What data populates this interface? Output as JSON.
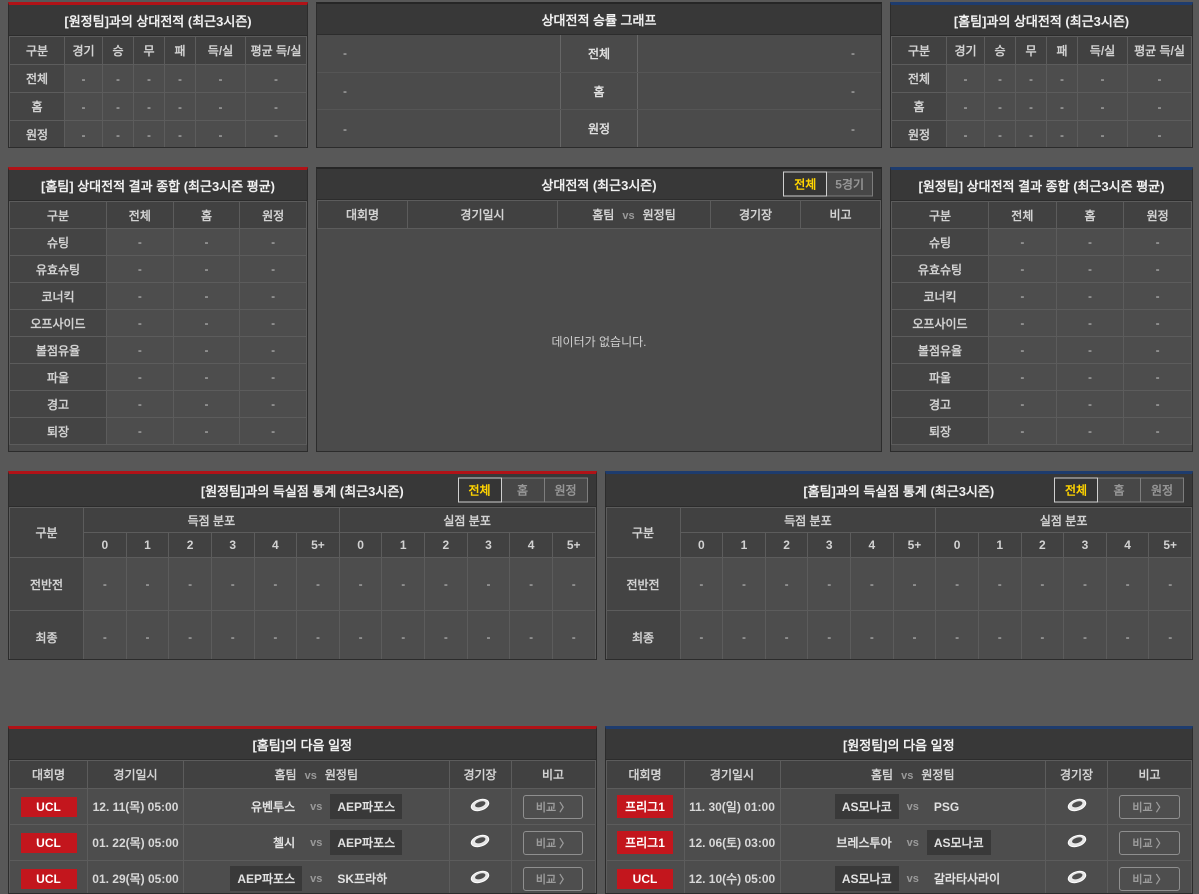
{
  "colors": {
    "accent_red": "#b11217",
    "accent_blue": "#1e3c6e",
    "badge_red": "#c3161d",
    "tab_active_text": "#ffd400",
    "page_background": "#585858"
  },
  "h2h_away": {
    "title": "[원정팀]과의 상대전적 (최근3시즌)",
    "columns": [
      "구분",
      "경기",
      "승",
      "무",
      "패",
      "득/실",
      "평균 득/실"
    ],
    "rows": [
      {
        "label": "전체",
        "values": [
          "-",
          "-",
          "-",
          "-",
          "-",
          "-"
        ]
      },
      {
        "label": "홈",
        "values": [
          "-",
          "-",
          "-",
          "-",
          "-",
          "-"
        ]
      },
      {
        "label": "원정",
        "values": [
          "-",
          "-",
          "-",
          "-",
          "-",
          "-"
        ]
      }
    ]
  },
  "winrate": {
    "title": "상대전적 승률 그래프",
    "rows": [
      {
        "left": "-",
        "label": "전체",
        "right": "-"
      },
      {
        "left": "-",
        "label": "홈",
        "right": "-"
      },
      {
        "left": "-",
        "label": "원정",
        "right": "-"
      }
    ]
  },
  "h2h_home": {
    "title": "[홈팀]과의 상대전적 (최근3시즌)",
    "columns": [
      "구분",
      "경기",
      "승",
      "무",
      "패",
      "득/실",
      "평균 득/실"
    ],
    "rows": [
      {
        "label": "전체",
        "values": [
          "-",
          "-",
          "-",
          "-",
          "-",
          "-"
        ]
      },
      {
        "label": "홈",
        "values": [
          "-",
          "-",
          "-",
          "-",
          "-",
          "-"
        ]
      },
      {
        "label": "원정",
        "values": [
          "-",
          "-",
          "-",
          "-",
          "-",
          "-"
        ]
      }
    ]
  },
  "summary_home": {
    "title": "[홈팀] 상대전적 결과 종합 (최근3시즌 평균)",
    "columns": [
      "구분",
      "전체",
      "홈",
      "원정"
    ],
    "rows": [
      {
        "label": "슈팅",
        "values": [
          "-",
          "-",
          "-"
        ]
      },
      {
        "label": "유효슈팅",
        "values": [
          "-",
          "-",
          "-"
        ]
      },
      {
        "label": "코너킥",
        "values": [
          "-",
          "-",
          "-"
        ]
      },
      {
        "label": "오프사이드",
        "values": [
          "-",
          "-",
          "-"
        ]
      },
      {
        "label": "볼점유율",
        "values": [
          "-",
          "-",
          "-"
        ]
      },
      {
        "label": "파울",
        "values": [
          "-",
          "-",
          "-"
        ]
      },
      {
        "label": "경고",
        "values": [
          "-",
          "-",
          "-"
        ]
      },
      {
        "label": "퇴장",
        "values": [
          "-",
          "-",
          "-"
        ]
      }
    ]
  },
  "matches": {
    "title": "상대전적 (최근3시즌)",
    "tabs": [
      {
        "label": "전체",
        "active": true
      },
      {
        "label": "5경기",
        "active": false
      }
    ],
    "header": {
      "league": "대회명",
      "datetime": "경기일시",
      "home": "홈팀",
      "vs": "vs",
      "away": "원정팀",
      "stadium": "경기장",
      "note": "비고"
    },
    "empty_message": "데이터가 없습니다."
  },
  "summary_away": {
    "title": "[원정팀] 상대전적 결과 종합 (최근3시즌 평균)",
    "columns": [
      "구분",
      "전체",
      "홈",
      "원정"
    ],
    "rows": [
      {
        "label": "슈팅",
        "values": [
          "-",
          "-",
          "-"
        ]
      },
      {
        "label": "유효슈팅",
        "values": [
          "-",
          "-",
          "-"
        ]
      },
      {
        "label": "코너킥",
        "values": [
          "-",
          "-",
          "-"
        ]
      },
      {
        "label": "오프사이드",
        "values": [
          "-",
          "-",
          "-"
        ]
      },
      {
        "label": "볼점유율",
        "values": [
          "-",
          "-",
          "-"
        ]
      },
      {
        "label": "파울",
        "values": [
          "-",
          "-",
          "-"
        ]
      },
      {
        "label": "경고",
        "values": [
          "-",
          "-",
          "-"
        ]
      },
      {
        "label": "퇴장",
        "values": [
          "-",
          "-",
          "-"
        ]
      }
    ]
  },
  "goals_away": {
    "title": "[원정팀]과의 득실점 통계 (최근3시즌)",
    "tabs": [
      {
        "label": "전체",
        "active": true
      },
      {
        "label": "홈",
        "active": false
      },
      {
        "label": "원정",
        "active": false
      }
    ],
    "corner": "구분",
    "groups": [
      "득점 분포",
      "실점 분포"
    ],
    "subcolumns": [
      "0",
      "1",
      "2",
      "3",
      "4",
      "5+"
    ],
    "rows": [
      {
        "label": "전반전",
        "values": [
          "-",
          "-",
          "-",
          "-",
          "-",
          "-",
          "-",
          "-",
          "-",
          "-",
          "-",
          "-"
        ]
      },
      {
        "label": "최종",
        "values": [
          "-",
          "-",
          "-",
          "-",
          "-",
          "-",
          "-",
          "-",
          "-",
          "-",
          "-",
          "-"
        ]
      }
    ]
  },
  "goals_home": {
    "title": "[홈팀]과의 득실점 통계 (최근3시즌)",
    "tabs": [
      {
        "label": "전체",
        "active": true
      },
      {
        "label": "홈",
        "active": false
      },
      {
        "label": "원정",
        "active": false
      }
    ],
    "corner": "구분",
    "groups": [
      "득점 분포",
      "실점 분포"
    ],
    "subcolumns": [
      "0",
      "1",
      "2",
      "3",
      "4",
      "5+"
    ],
    "rows": [
      {
        "label": "전반전",
        "values": [
          "-",
          "-",
          "-",
          "-",
          "-",
          "-",
          "-",
          "-",
          "-",
          "-",
          "-",
          "-"
        ]
      },
      {
        "label": "최종",
        "values": [
          "-",
          "-",
          "-",
          "-",
          "-",
          "-",
          "-",
          "-",
          "-",
          "-",
          "-",
          "-"
        ]
      }
    ]
  },
  "schedule_home": {
    "title": "[홈팀]의 다음 일정",
    "header": {
      "league": "대회명",
      "datetime": "경기일시",
      "home": "홈팀",
      "vs": "vs",
      "away": "원정팀",
      "stadium": "경기장",
      "note": "비고"
    },
    "compare_label": "비교 〉",
    "rows": [
      {
        "league": "UCL",
        "datetime": "12. 11(목) 05:00",
        "home": "유벤투스",
        "away": "AEP파포스",
        "highlight": "away"
      },
      {
        "league": "UCL",
        "datetime": "01. 22(목) 05:00",
        "home": "첼시",
        "away": "AEP파포스",
        "highlight": "away"
      },
      {
        "league": "UCL",
        "datetime": "01. 29(목) 05:00",
        "home": "AEP파포스",
        "away": "SK프라하",
        "highlight": "home"
      }
    ]
  },
  "schedule_away": {
    "title": "[원정팀]의 다음 일정",
    "header": {
      "league": "대회명",
      "datetime": "경기일시",
      "home": "홈팀",
      "vs": "vs",
      "away": "원정팀",
      "stadium": "경기장",
      "note": "비고"
    },
    "compare_label": "비교 〉",
    "rows": [
      {
        "league": "프리그1",
        "datetime": "11. 30(일) 01:00",
        "home": "AS모나코",
        "away": "PSG",
        "highlight": "home"
      },
      {
        "league": "프리그1",
        "datetime": "12. 06(토) 03:00",
        "home": "브레스투아",
        "away": "AS모나코",
        "highlight": "away"
      },
      {
        "league": "UCL",
        "datetime": "12. 10(수) 05:00",
        "home": "AS모나코",
        "away": "갈라타사라이",
        "highlight": "home"
      }
    ]
  }
}
